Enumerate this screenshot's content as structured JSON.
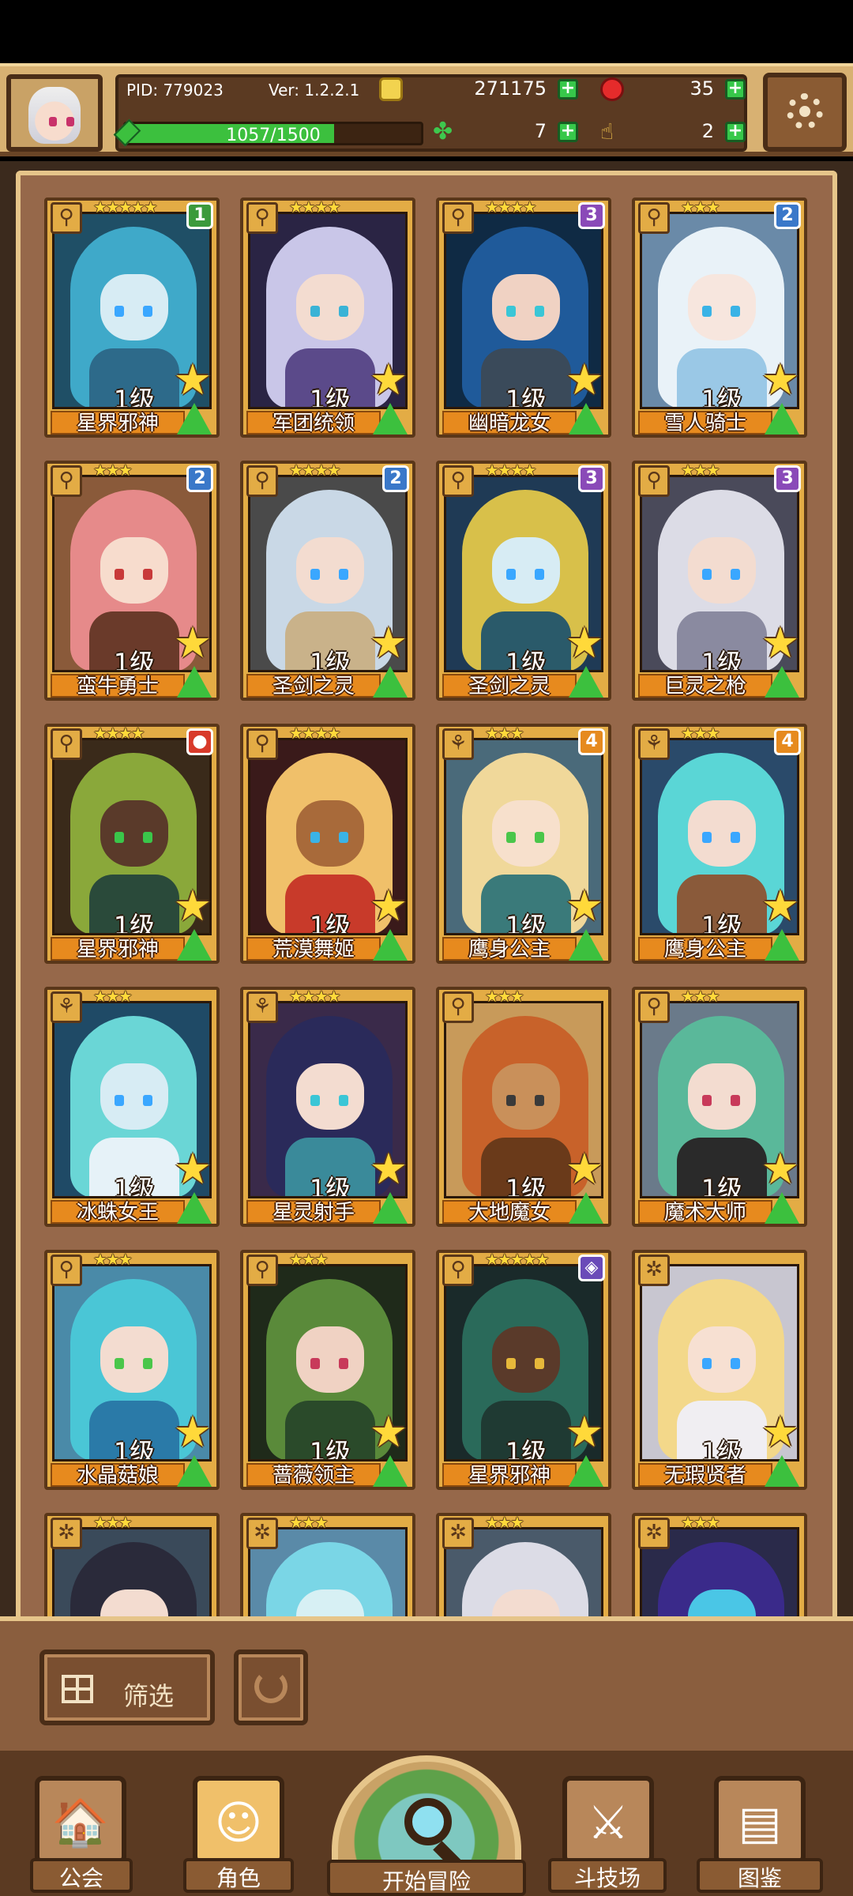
{
  "header": {
    "pid": "PID: 779023",
    "version": "Ver: 1.2.2.1",
    "gold": "271175",
    "gems": "35",
    "clover": "7",
    "boost": "2",
    "exp_text": "1057/1500",
    "exp_progress": 0.705
  },
  "heroes": [
    {
      "name": "星界邪神",
      "level": "1级",
      "stars": "★★★★★",
      "rank": "1",
      "rank_color": "#3c9a3c",
      "type": "⚲",
      "palette": {
        "hair": "#3fa9c9",
        "skin": "#d7ecf4",
        "body": "#2d6a8a",
        "bg": "#1f4f66",
        "eye": "#3aa7ff"
      }
    },
    {
      "name": "军团统领",
      "level": "1级",
      "stars": "★★★★",
      "rank": "",
      "rank_color": "",
      "type": "⚲",
      "palette": {
        "hair": "#c9c6e8",
        "skin": "#f3dcd0",
        "body": "#5b4a8a",
        "bg": "#2a2444",
        "eye": "#3ab3d6"
      }
    },
    {
      "name": "幽暗龙女",
      "level": "1级",
      "stars": "★★★★",
      "rank": "3",
      "rank_color": "#8a4ab8",
      "type": "⚲",
      "palette": {
        "hair": "#1f5a9a",
        "skin": "#f0d2c3",
        "body": "#3a4a5a",
        "bg": "#0f2a44",
        "eye": "#3ac6d6"
      }
    },
    {
      "name": "雪人骑士",
      "level": "1级",
      "stars": "★★★",
      "rank": "2",
      "rank_color": "#3a78c9",
      "type": "⚲",
      "palette": {
        "hair": "#e9f2f8",
        "skin": "#f7e6de",
        "body": "#9ac8e6",
        "bg": "#6a8aa8",
        "eye": "#3ab3e6"
      }
    },
    {
      "name": "蛮牛勇士",
      "level": "1级",
      "stars": "★★★",
      "rank": "2",
      "rank_color": "#3a78c9",
      "type": "⚲",
      "palette": {
        "hair": "#e68a8a",
        "skin": "#f7dccd",
        "body": "#6a3a2a",
        "bg": "#8a5a3a",
        "eye": "#c83a3a"
      }
    },
    {
      "name": "圣剑之灵",
      "level": "1级",
      "stars": "★★★★",
      "rank": "2",
      "rank_color": "#3a78c9",
      "type": "⚲",
      "palette": {
        "hair": "#c9d8e6",
        "skin": "#f3dcd0",
        "body": "#c9b28a",
        "bg": "#4a4a4a",
        "eye": "#3aa7ff"
      }
    },
    {
      "name": "圣剑之灵",
      "level": "1级",
      "stars": "★★★★",
      "rank": "3",
      "rank_color": "#8a4ab8",
      "type": "⚲",
      "palette": {
        "hair": "#d8c04a",
        "skin": "#d7ecf4",
        "body": "#2a5a6a",
        "bg": "#1f3a55",
        "eye": "#3aa7ff"
      }
    },
    {
      "name": "巨灵之枪",
      "level": "1级",
      "stars": "★★★",
      "rank": "3",
      "rank_color": "#8a4ab8",
      "type": "⚲",
      "palette": {
        "hair": "#dcdce6",
        "skin": "#f3dcd0",
        "body": "#8a8aa0",
        "bg": "#4a4a5a",
        "eye": "#3aa7ff"
      }
    },
    {
      "name": "星界邪神",
      "level": "1级",
      "stars": "★★★★",
      "rank": "●",
      "rank_color": "#d83a2a",
      "type": "⚲",
      "palette": {
        "hair": "#8aa83a",
        "skin": "#5a3a2a",
        "body": "#2a4a3a",
        "bg": "#3a2a1a",
        "eye": "#3ac64a"
      }
    },
    {
      "name": "荒漠舞姬",
      "level": "1级",
      "stars": "★★★★",
      "rank": "",
      "rank_color": "",
      "type": "⚲",
      "palette": {
        "hair": "#f0c06a",
        "skin": "#a86a3a",
        "body": "#c83a2a",
        "bg": "#3a1a1a",
        "eye": "#3ab3e6"
      }
    },
    {
      "name": "鹰身公主",
      "level": "1级",
      "stars": "★★★",
      "rank": "4",
      "rank_color": "#e68a1e",
      "type": "⚘",
      "palette": {
        "hair": "#f0d89a",
        "skin": "#f7e0cc",
        "body": "#3a7a7a",
        "bg": "#4a6a7a",
        "eye": "#4ac64a"
      }
    },
    {
      "name": "鹰身公主",
      "level": "1级",
      "stars": "★★★",
      "rank": "4",
      "rank_color": "#e68a1e",
      "type": "⚘",
      "palette": {
        "hair": "#5ad6d6",
        "skin": "#f3dcd0",
        "body": "#8a5a3a",
        "bg": "#2a4a6a",
        "eye": "#3aa7ff"
      }
    },
    {
      "name": "冰蛛女王",
      "level": "1级",
      "stars": "★★★",
      "rank": "",
      "rank_color": "",
      "type": "⚘",
      "palette": {
        "hair": "#6ad6d6",
        "skin": "#d7ecf4",
        "body": "#e6f2f8",
        "bg": "#1f4a66",
        "eye": "#3aa7ff"
      }
    },
    {
      "name": "星灵射手",
      "level": "1级",
      "stars": "★★★★",
      "rank": "",
      "rank_color": "",
      "type": "⚘",
      "palette": {
        "hair": "#2a2a5a",
        "skin": "#f3dcd0",
        "body": "#3a8a9a",
        "bg": "#3a2a4a",
        "eye": "#3ac6d6"
      }
    },
    {
      "name": "大地魔女",
      "level": "1级",
      "stars": "★★★",
      "rank": "",
      "rank_color": "",
      "type": "⚲",
      "palette": {
        "hair": "#c8622a",
        "skin": "#c9905a",
        "body": "#6a3a1a",
        "bg": "#c89a5a",
        "eye": "#3a3a3a"
      }
    },
    {
      "name": "魔术大师",
      "level": "1级",
      "stars": "★★★",
      "rank": "",
      "rank_color": "",
      "type": "⚲",
      "palette": {
        "hair": "#5ab89a",
        "skin": "#f3dcd0",
        "body": "#2a2a2a",
        "bg": "#6a7a8a",
        "eye": "#c83a5a"
      }
    },
    {
      "name": "水晶菇娘",
      "level": "1级",
      "stars": "★★★",
      "rank": "",
      "rank_color": "",
      "type": "⚲",
      "palette": {
        "hair": "#4ac6d6",
        "skin": "#f3dcd0",
        "body": "#2a7aa8",
        "bg": "#4a8aa8",
        "eye": "#4ac64a"
      }
    },
    {
      "name": "蔷薇领主",
      "level": "1级",
      "stars": "★★★",
      "rank": "",
      "rank_color": "",
      "type": "⚲",
      "palette": {
        "hair": "#5a8a3a",
        "skin": "#f0d2c3",
        "body": "#2a4a2a",
        "bg": "#1f2a1a",
        "eye": "#c83a5a"
      }
    },
    {
      "name": "星界邪神",
      "level": "1级",
      "stars": "★★★★★",
      "rank": "◈",
      "rank_color": "#6a4ab8",
      "type": "⚲",
      "palette": {
        "hair": "#2a6a5a",
        "skin": "#5a3a2a",
        "body": "#1f3a33",
        "bg": "#1a2a2a",
        "eye": "#e6b83a"
      }
    },
    {
      "name": "无瑕贤者",
      "level": "1级",
      "stars": "",
      "rank": "",
      "rank_color": "",
      "type": "✲",
      "palette": {
        "hair": "#f3d88a",
        "skin": "#f7e0d2",
        "body": "#f0eef2",
        "bg": "#c8c6d0",
        "eye": "#3aa7ff"
      }
    }
  ],
  "partial_heroes": [
    {
      "stars": "★★★",
      "type": "✲",
      "palette": {
        "hair": "#2a2a3a",
        "skin": "#f3dcd0",
        "bg": "#3a4a5a"
      }
    },
    {
      "stars": "★★★",
      "type": "✲",
      "palette": {
        "hair": "#7ad6e6",
        "skin": "#d7f0f4",
        "bg": "#5a8aa8"
      }
    },
    {
      "stars": "★★★",
      "type": "✲",
      "palette": {
        "hair": "#dcdce6",
        "skin": "#f3dcd0",
        "bg": "#4a5a6a"
      }
    },
    {
      "stars": "★★★",
      "type": "✲",
      "palette": {
        "hair": "#3a2a8a",
        "skin": "#4ac6e6",
        "bg": "#2a2a4a"
      }
    }
  ],
  "filter": {
    "label": "筛选"
  },
  "nav": {
    "guild": "公会",
    "characters": "角色",
    "adventure": "开始冒险",
    "arena": "斗技场",
    "codex": "图鉴"
  }
}
